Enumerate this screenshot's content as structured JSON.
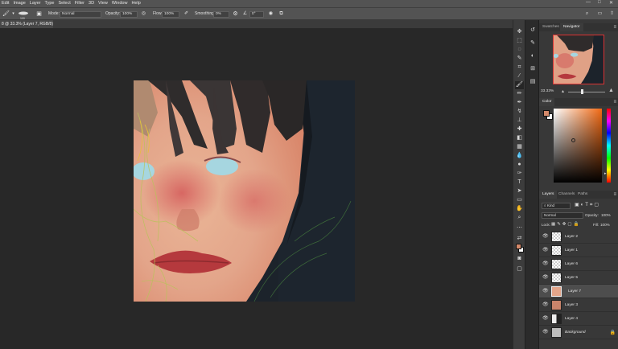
{
  "menu": [
    "Edit",
    "Image",
    "Layer",
    "Type",
    "Select",
    "Filter",
    "3D",
    "View",
    "Window",
    "Help"
  ],
  "window_controls": [
    "—",
    "□",
    "✕"
  ],
  "options": {
    "mode_label": "Mode:",
    "mode_value": "Normal",
    "opacity_label": "Opacity:",
    "opacity_value": "100%",
    "flow_label": "Flow:",
    "flow_value": "100%",
    "smoothing_label": "Smoothing:",
    "smoothing_value": "0%",
    "angle_value": "0°",
    "brush_size": "100"
  },
  "top_right_icons": [
    "search-icon",
    "workspace-icon",
    "share-icon"
  ],
  "document_tab": {
    "title": "8 @ 33.3% (Layer 7, RGB/8) *",
    "close": "×"
  },
  "panels": {
    "navigator": {
      "tabs": [
        "Swatches",
        "Navigator"
      ],
      "active_tab": "Navigator",
      "zoom": "33.33%"
    },
    "color": {
      "tab": "Color",
      "foreground": "#d4896a",
      "background": "#ffffff"
    },
    "layers": {
      "tabs": [
        "Layers",
        "Channels",
        "Paths"
      ],
      "active_tab": "Layers",
      "filter_kind": "Kind",
      "blend_mode": "Normal",
      "opacity_label": "Opacity:",
      "opacity_value": "100%",
      "lock_label": "Lock:",
      "fill_label": "Fill:",
      "fill_value": "100%",
      "items": [
        {
          "name": "Layer 2",
          "selected": false
        },
        {
          "name": "Layer 1",
          "selected": false
        },
        {
          "name": "Layer 6",
          "selected": false
        },
        {
          "name": "Layer 5",
          "selected": false
        },
        {
          "name": "Layer 7",
          "selected": true
        },
        {
          "name": "Layer 3",
          "selected": false
        },
        {
          "name": "Layer 4",
          "selected": false
        },
        {
          "name": "Background",
          "selected": false
        }
      ]
    }
  }
}
